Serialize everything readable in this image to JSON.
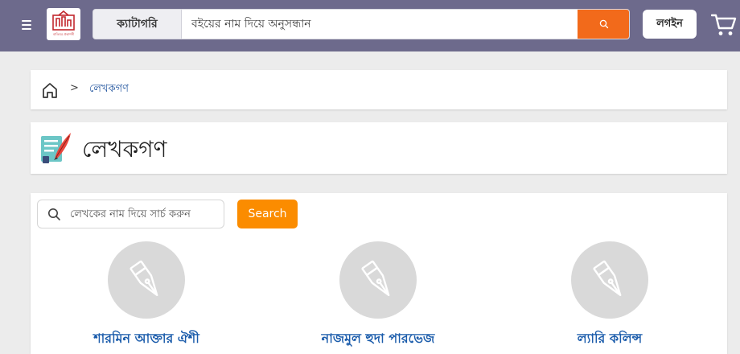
{
  "header": {
    "logo_text": "বাতিঘর প্রকাশনী",
    "category_label": "ক্যাটাগরি",
    "search_placeholder": "বইয়ের নাম দিয়ে অনুসন্ধান",
    "login_label": "লগইন"
  },
  "breadcrumb": {
    "separator": ">",
    "current": "লেখকগণ"
  },
  "page": {
    "title": "লেখকগণ"
  },
  "author_search": {
    "placeholder": "লেখকের নাম দিয়ে সার্চ করুন",
    "button_label": "Search"
  },
  "authors": [
    {
      "name": "শারমিন আক্তার ঐশী"
    },
    {
      "name": "নাজমুল হুদা পারভেজ"
    },
    {
      "name": "ল্যারি কলিন্স"
    }
  ],
  "colors": {
    "header_bg": "#6d6a8c",
    "accent_orange": "#f26a1b",
    "button_orange": "#fb8c00",
    "link_blue": "#1b5cab"
  }
}
